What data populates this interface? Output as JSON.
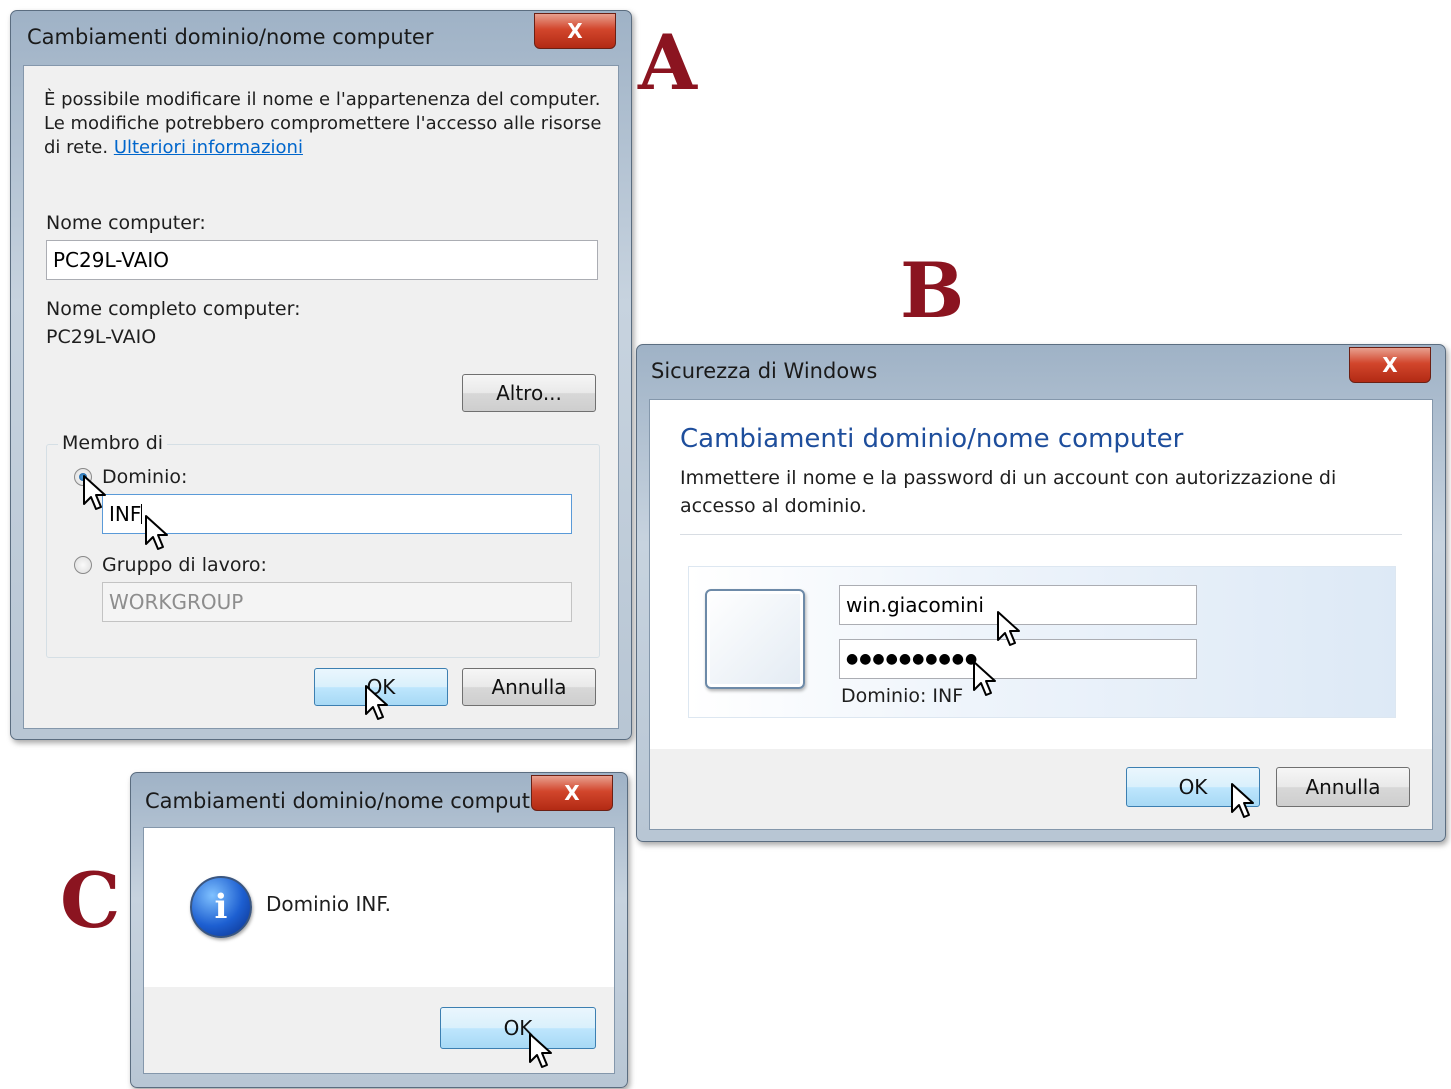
{
  "panel_labels": {
    "a": "A",
    "b": "B",
    "c": "C"
  },
  "dialog_a": {
    "title": "Cambiamenti dominio/nome computer",
    "close_label": "X",
    "description": "È possibile modificare il nome e l'appartenenza del computer. Le modifiche potrebbero compromettere l'accesso alle risorse di rete.",
    "more_info_link": "Ulteriori informazioni",
    "computer_name_label": "Nome computer:",
    "computer_name_value": "PC29L-VAIO",
    "full_name_label": "Nome completo computer:",
    "full_name_value": "PC29L-VAIO",
    "more_button": "Altro...",
    "member_of_label": "Membro di",
    "domain_label": "Dominio:",
    "domain_value": "INF",
    "workgroup_label": "Gruppo di lavoro:",
    "workgroup_value": "WORKGROUP",
    "ok_button": "OK",
    "cancel_button": "Annulla"
  },
  "dialog_b": {
    "title": "Sicurezza di Windows",
    "close_label": "X",
    "heading": "Cambiamenti dominio/nome computer",
    "instructions": "Immettere il nome e la password di un account con autorizzazione di accesso al dominio.",
    "username_value": "win.giacomini",
    "password_value": "●●●●●●●●●●",
    "domain_text": "Dominio: INF",
    "ok_button": "OK",
    "cancel_button": "Annulla"
  },
  "dialog_c": {
    "title": "Cambiamenti dominio/nome comput...",
    "close_label": "X",
    "message": "Dominio INF.",
    "info_glyph": "i",
    "ok_button": "OK"
  },
  "colors": {
    "panel_letter": "#8b1420",
    "link": "#0066cc",
    "heading_blue": "#1e4e9c",
    "close_red": "#d2462c"
  }
}
